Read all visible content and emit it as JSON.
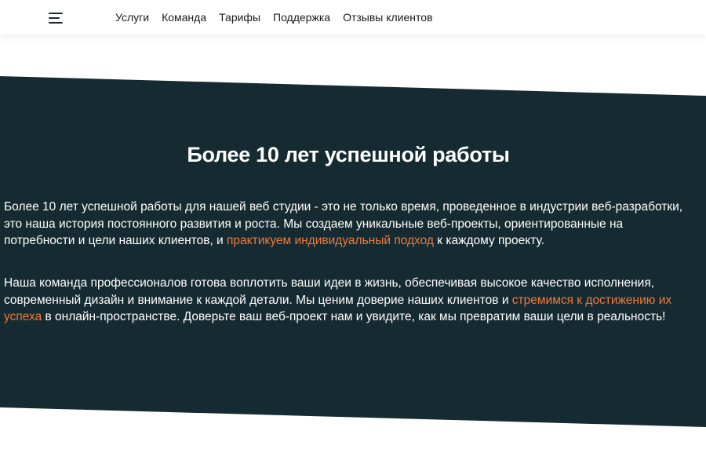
{
  "nav": {
    "menu_icon": "hamburger-menu-icon",
    "items": [
      {
        "label": "Услуги"
      },
      {
        "label": "Команда"
      },
      {
        "label": "Тарифы"
      },
      {
        "label": "Поддержка"
      },
      {
        "label": "Отзывы клиентов"
      }
    ]
  },
  "hero": {
    "title": "Более 10 лет успешной работы",
    "paragraph1": {
      "before": "Более 10 лет успешной работы для нашей веб студии - это не только время, проведенное в индустрии веб-разработки, это наша история постоянного развития и роста. Мы создаем уникальные веб-проекты, ориентированные на потребности и цели наших клиентов, и ",
      "highlight": "практикуем индивидуальный подход",
      "after": " к каждому проекту."
    },
    "paragraph2": {
      "before": "Наша команда профессионалов готова воплотить ваши идеи в жизнь, обеспечивая высокое качество исполнения, современный дизайн и внимание к каждой детали. Мы ценим доверие наших клиентов и ",
      "highlight": "стремимся к достижению их успеха",
      "after": " в онлайн-пространстве. Доверьте ваш веб-проект нам и увидите, как мы превратим ваши цели в реальность!"
    }
  },
  "colors": {
    "band_background": "#162b31",
    "accent": "#ef7a3a",
    "nav_text": "#1b1b1b"
  }
}
